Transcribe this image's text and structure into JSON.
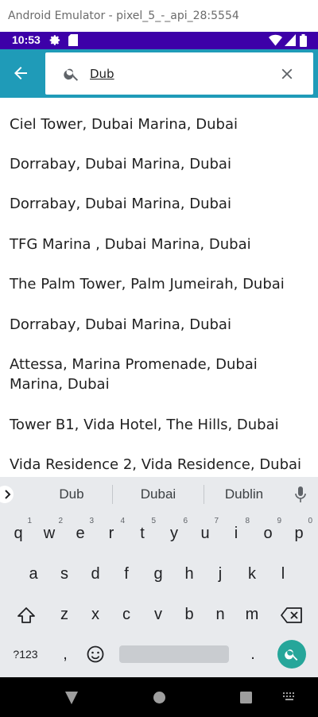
{
  "window": {
    "title": "Android Emulator - pixel_5_-_api_28:5554"
  },
  "status_bar": {
    "time": "10:53"
  },
  "search": {
    "query": "Dub",
    "placeholder": ""
  },
  "results": [
    "Ciel Tower, Dubai Marina, Dubai",
    "Dorrabay, Dubai Marina, Dubai",
    "Dorrabay, Dubai Marina, Dubai",
    "TFG Marina , Dubai Marina, Dubai",
    "The Palm Tower, Palm Jumeirah, Dubai",
    "Dorrabay, Dubai Marina, Dubai",
    "Attessa, Marina Promenade, Dubai Marina, Dubai",
    "Tower B1, Vida Hotel, The Hills, Dubai",
    "Vida Residence 2, Vida Residence, Dubai"
  ],
  "keyboard": {
    "suggestions": [
      "Dub",
      "Dubai",
      "Dublin"
    ],
    "row1": [
      "q",
      "w",
      "e",
      "r",
      "t",
      "y",
      "u",
      "i",
      "o",
      "p"
    ],
    "row1_hints": [
      "1",
      "2",
      "3",
      "4",
      "5",
      "6",
      "7",
      "8",
      "9",
      "0"
    ],
    "row2": [
      "a",
      "s",
      "d",
      "f",
      "g",
      "h",
      "j",
      "k",
      "l"
    ],
    "row3": [
      "z",
      "x",
      "c",
      "v",
      "b",
      "n",
      "m"
    ],
    "symbols_label": "?123",
    "comma": ",",
    "period": "."
  },
  "colors": {
    "status_bar": "#3d00a8",
    "app_bar": "#1f9bb8",
    "keyboard_bg": "#e8eaed",
    "search_key": "#26a69a"
  }
}
